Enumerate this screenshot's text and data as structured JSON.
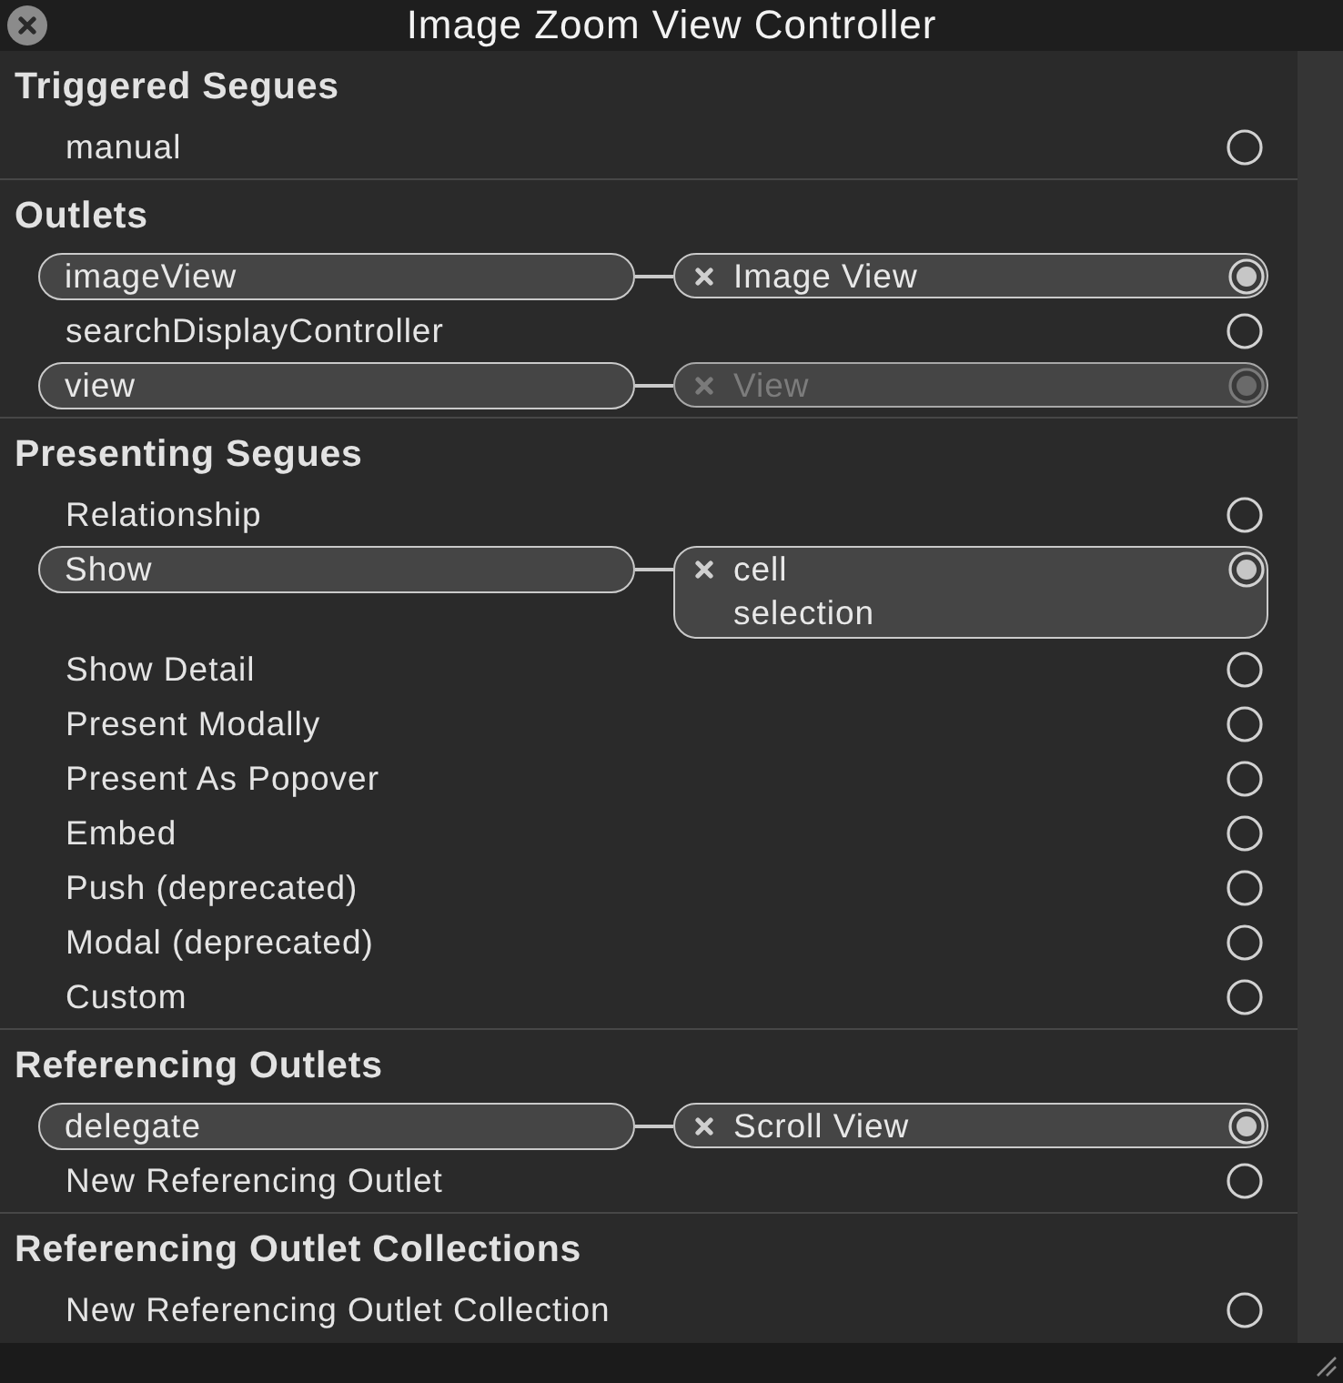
{
  "window": {
    "title": "Image Zoom View Controller"
  },
  "sections": [
    {
      "title": "Triggered Segues",
      "rows": [
        {
          "label": "manual",
          "connected": false
        }
      ]
    },
    {
      "title": "Outlets",
      "rows": [
        {
          "label": "imageView",
          "connected": true,
          "target": {
            "lines": [
              "Image View"
            ],
            "disabled": false
          }
        },
        {
          "label": "searchDisplayController",
          "connected": false
        },
        {
          "label": "view",
          "connected": true,
          "target": {
            "lines": [
              "View"
            ],
            "disabled": true
          }
        }
      ]
    },
    {
      "title": "Presenting Segues",
      "rows": [
        {
          "label": "Relationship",
          "connected": false
        },
        {
          "label": "Show",
          "connected": true,
          "target": {
            "lines": [
              "cell",
              "selection"
            ],
            "disabled": false
          }
        },
        {
          "label": "Show Detail",
          "connected": false
        },
        {
          "label": "Present Modally",
          "connected": false
        },
        {
          "label": "Present As Popover",
          "connected": false
        },
        {
          "label": "Embed",
          "connected": false
        },
        {
          "label": "Push (deprecated)",
          "connected": false
        },
        {
          "label": "Modal (deprecated)",
          "connected": false
        },
        {
          "label": "Custom",
          "connected": false
        }
      ]
    },
    {
      "title": "Referencing Outlets",
      "rows": [
        {
          "label": "delegate",
          "connected": true,
          "target": {
            "lines": [
              "Scroll View"
            ],
            "disabled": false
          }
        },
        {
          "label": "New Referencing Outlet",
          "connected": false
        }
      ]
    },
    {
      "title": "Referencing Outlet Collections",
      "rows": [
        {
          "label": "New Referencing Outlet Collection",
          "connected": false
        }
      ]
    }
  ]
}
